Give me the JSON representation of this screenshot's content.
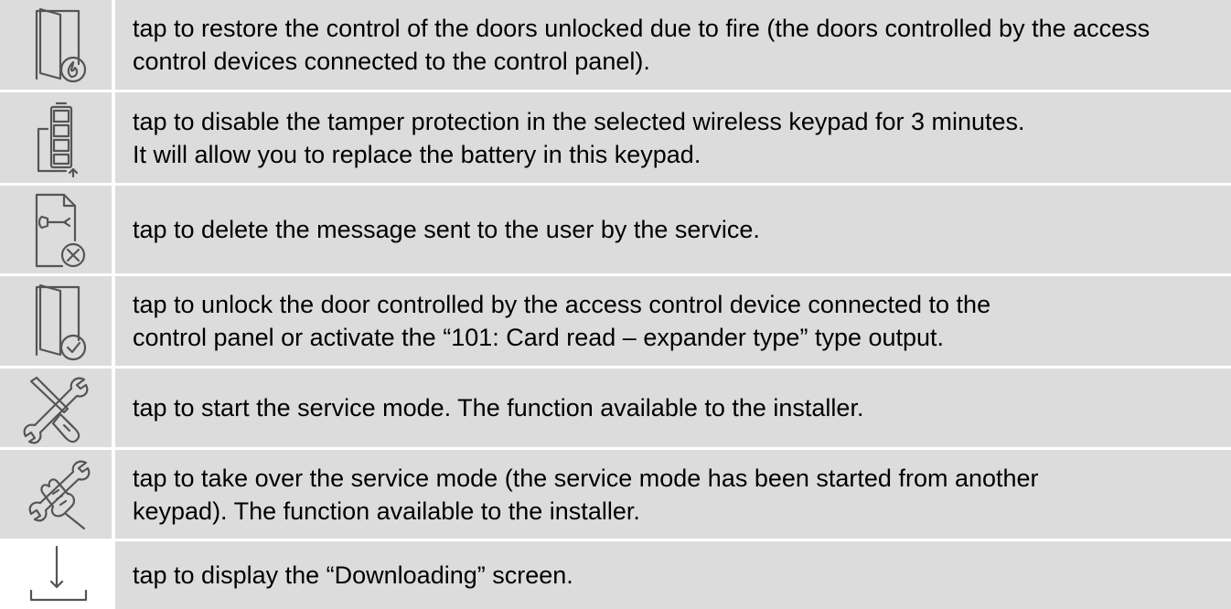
{
  "rows": [
    {
      "icon": "door-fire-icon",
      "text": "tap to restore the control of the doors unlocked due to fire (the doors controlled by the access control devices connected to the control panel)."
    },
    {
      "icon": "keypad-battery-icon",
      "text": "tap to disable the tamper protection in the selected wireless keypad for 3 minutes.\nIt will allow you to replace the battery in this keypad."
    },
    {
      "icon": "delete-service-message-icon",
      "text": "tap to delete the message sent to the user by the service."
    },
    {
      "icon": "door-unlock-icon",
      "text": "tap to unlock the door controlled by the access control device connected to the\ncontrol panel or activate the “101: Card read – expander type” type output."
    },
    {
      "icon": "service-mode-tools-icon",
      "text": "tap to start the service mode. The function available to the installer."
    },
    {
      "icon": "take-over-service-mode-icon",
      "text": "tap to take over the service mode (the service mode has been started from another\nkeypad). The function available to the installer."
    },
    {
      "icon": "downloading-icon",
      "text": "tap to display the “Downloading” screen."
    }
  ]
}
